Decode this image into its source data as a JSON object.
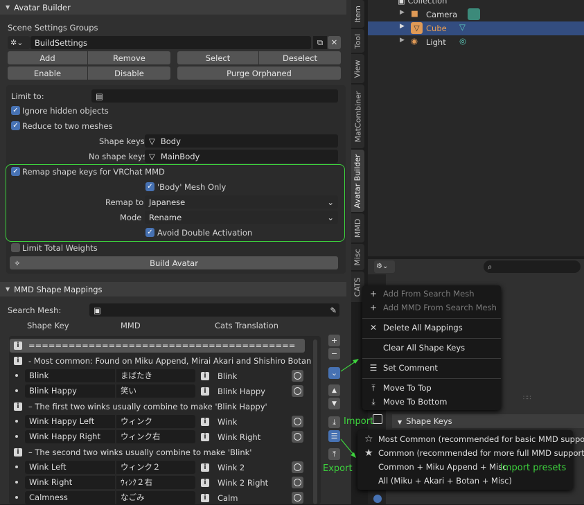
{
  "avatar_panel": {
    "title": "Avatar Builder",
    "scene_settings_label": "Scene Settings Groups",
    "group_name": "BuildSettings",
    "buttons": {
      "add": "Add",
      "remove": "Remove",
      "select": "Select",
      "deselect": "Deselect",
      "enable": "Enable",
      "disable": "Disable",
      "purge": "Purge Orphaned"
    },
    "limit_to": "Limit to:",
    "ignore_hidden": "Ignore hidden objects",
    "reduce_two": "Reduce to two meshes",
    "shape_keys_label": "Shape keys",
    "shape_keys_value": "Body",
    "no_shape_keys_label": "No shape keys",
    "no_shape_keys_value": "MainBody",
    "remap": "Remap shape keys for VRChat MMD",
    "body_only": "'Body' Mesh Only",
    "remap_to_label": "Remap to",
    "remap_to_value": "Japanese",
    "mode_label": "Mode",
    "mode_value": "Rename",
    "avoid_double": "Avoid Double Activation",
    "limit_weights": "Limit Total Weights",
    "build": "Build Avatar"
  },
  "mmd_panel": {
    "title": "MMD Shape Mappings",
    "search_mesh_label": "Search Mesh:",
    "col_shape_key": "Shape Key",
    "col_mmd": "MMD",
    "col_cats": "Cats Translation",
    "comment_rows": [
      "========================================",
      "- Most common: Found on Miku Append, Mirai Akari and Shishiro Botan",
      "– The first two winks usually combine to make 'Blink Happy'",
      "– The second two winks usually combine to make 'Blink'"
    ],
    "rows": [
      {
        "key": "Blink",
        "mmd": "まばたき",
        "cats": "Blink"
      },
      {
        "key": "Blink Happy",
        "mmd": "笑い",
        "cats": "Blink Happy"
      },
      {
        "key": "Wink Happy Left",
        "mmd": "ウィンク",
        "cats": "Wink"
      },
      {
        "key": "Wink Happy Right",
        "mmd": "ウィンク右",
        "cats": "Wink Right"
      },
      {
        "key": "Wink Left",
        "mmd": "ウィンク２",
        "cats": "Wink 2"
      },
      {
        "key": "Wink Right",
        "mmd": "ｳｨﾝｸ２右",
        "cats": "Wink 2 Right"
      },
      {
        "key": "Calmness",
        "mmd": "なごみ",
        "cats": "Calm"
      }
    ]
  },
  "tabs": [
    "Item",
    "Tool",
    "View",
    "MatCombiner",
    "Avatar Builder",
    "MMD",
    "Misc",
    "CATS"
  ],
  "outliner": {
    "collection": "Collection",
    "camera": "Camera",
    "cube": "Cube",
    "light": "Light"
  },
  "context_menu": {
    "add_from_search": "Add From Search Mesh",
    "add_mmd_from_search": "Add MMD From Search Mesh",
    "delete_all": "Delete All Mappings",
    "clear_all": "Clear All Shape Keys",
    "set_comment": "Set Comment",
    "move_top": "Move To Top",
    "move_bottom": "Move To Bottom"
  },
  "presets_menu": {
    "most_common": "Most Common (recommended for basic MMD support)",
    "common": "Common (recommended for more full MMD support)",
    "common_miku": "Common + Miku Append + Misc",
    "all": "All (Miku + Akari + Botan + Misc)"
  },
  "shape_keys_header": "Shape Keys",
  "annotations": {
    "import": "Import",
    "export": "Export",
    "import_presets": "Import presets"
  },
  "colors": {
    "accent": "#4772b3",
    "green": "#3dd23d",
    "panel": "#303030",
    "field": "#1d1d1d"
  }
}
